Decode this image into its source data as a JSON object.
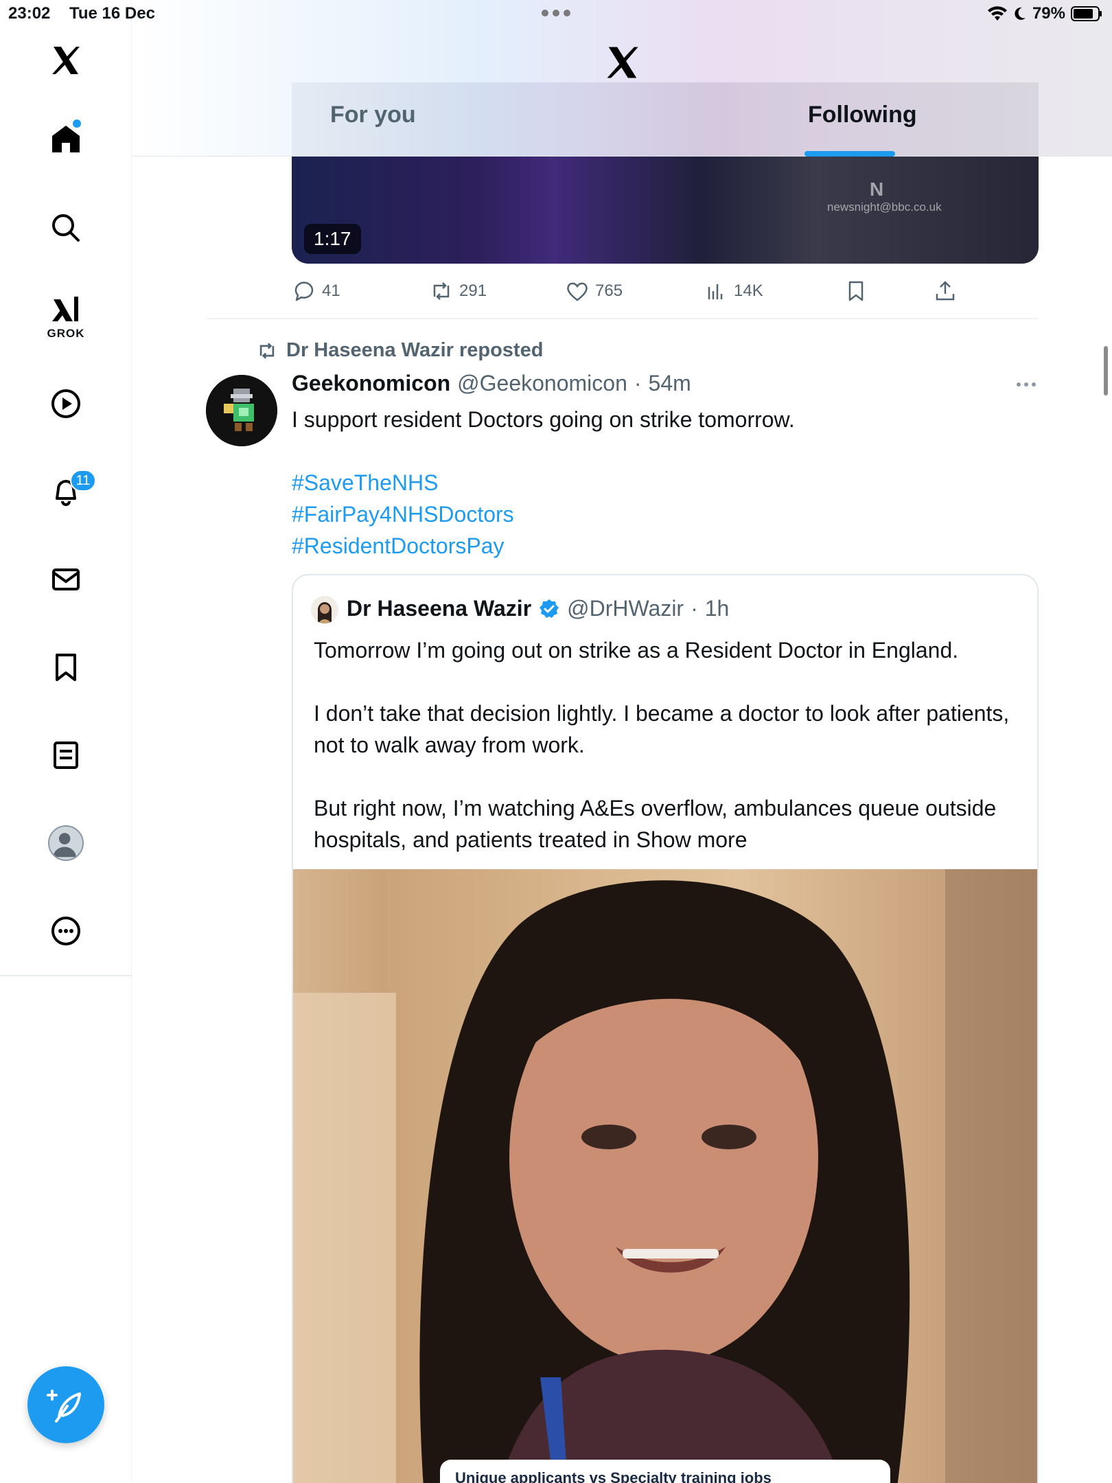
{
  "status": {
    "time": "23:02",
    "date": "Tue 16 Dec",
    "battery": "79%"
  },
  "sidebar": {
    "items": [
      {
        "name": "x-logo-icon"
      },
      {
        "name": "home-icon"
      },
      {
        "name": "search-icon"
      },
      {
        "name": "grok-icon",
        "label": "GROK"
      },
      {
        "name": "video-icon"
      },
      {
        "name": "notifications-icon",
        "badge": "11"
      },
      {
        "name": "messages-icon"
      },
      {
        "name": "bookmarks-icon"
      },
      {
        "name": "lists-icon"
      },
      {
        "name": "profile-icon"
      },
      {
        "name": "more-icon"
      }
    ],
    "compose": "compose-icon"
  },
  "header": {
    "tabs": [
      {
        "label": "For you",
        "active": false
      },
      {
        "label": "Following",
        "active": true
      }
    ]
  },
  "prev_post": {
    "video_duration": "1:17",
    "watermark": "newsnight@bbc.co.uk",
    "actions": {
      "replies": "41",
      "reposts": "291",
      "likes": "765",
      "views": "14K"
    }
  },
  "post": {
    "repost_by": "Dr Haseena Wazir reposted",
    "name": "Geekonomicon",
    "handle": "@Geekonomicon",
    "dot": "·",
    "time": "54m",
    "text": "I support resident Doctors going on strike tomorrow.",
    "hashtags": [
      "#SaveTheNHS",
      "#FairPay4NHSDoctors",
      "#ResidentDoctorsPay"
    ]
  },
  "quote": {
    "name": "Dr Haseena Wazir",
    "handle": "@DrHWazir",
    "dot": "·",
    "time": "1h",
    "paragraphs": [
      "Tomorrow I’m going out on strike as a Resident Doctor in England.",
      "I don’t take that decision lightly. I became a doctor to look after patients, not to walk away from work.",
      "But right now, I’m watching A&Es overflow, ambulances queue outside hospitals, and patients treated in"
    ],
    "show_more": "Show more",
    "media_caption": "Unique applicants vs Specialty training jobs"
  },
  "colors": {
    "accent": "#1d9bf0",
    "text": "#0f1419",
    "secondary": "#536471"
  }
}
